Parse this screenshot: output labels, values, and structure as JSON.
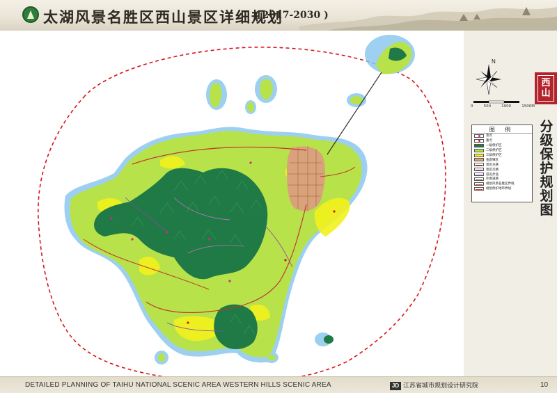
{
  "header": {
    "title": "太湖风景名胜区西山景区详细规划",
    "years": "( 2017-2030 )"
  },
  "side": {
    "tab_label": [
      "西",
      "山"
    ],
    "vertical_title": [
      "分",
      "级",
      "保",
      "护",
      "规",
      "划",
      "图"
    ],
    "compass_letter": "N",
    "scale_labels": [
      "0",
      "500",
      "1000",
      "1500M"
    ]
  },
  "legend": {
    "title": "图 例",
    "items": [
      {
        "label": "景点",
        "kind": "dot",
        "color": "#e0208a"
      },
      {
        "label": "重点",
        "kind": "dot",
        "color": "#d8141a"
      },
      {
        "label": "一级保护区",
        "kind": "fill",
        "color": "#1f7a45"
      },
      {
        "label": "二级保护区",
        "kind": "fill",
        "color": "#b7e24a"
      },
      {
        "label": "三级保护区",
        "kind": "fill",
        "color": "#f2f21c"
      },
      {
        "label": "金庭镇区",
        "kind": "fill",
        "color": "#d9a27a"
      },
      {
        "label": "景区主路",
        "kind": "line",
        "color": "#c0392b"
      },
      {
        "label": "景区次路",
        "kind": "line",
        "color": "#8e44ad"
      },
      {
        "label": "游览步道",
        "kind": "line",
        "color": "#c874c8"
      },
      {
        "label": "外围道路",
        "kind": "line",
        "color": "#777777"
      },
      {
        "label": "规划风景名胜区界线",
        "kind": "dash",
        "color": "#c0392b"
      },
      {
        "label": "规划保护地带界线",
        "kind": "dash",
        "color": "#d8141a"
      }
    ]
  },
  "footer": {
    "text": "DETAILED PLANNING OF TAIHU NATIONAL SCENIC AREA WESTERN HILLS SCENIC AREA",
    "org_mark": "JD",
    "org": "江苏省城市规划设计研究院",
    "page_number": "10"
  },
  "colors": {
    "level1": "#1f7a45",
    "level2": "#b7e24a",
    "level3": "#f2f21c",
    "town": "#d9a27a",
    "water_halo": "#6fb9e8",
    "boundary": "#d8141a"
  }
}
